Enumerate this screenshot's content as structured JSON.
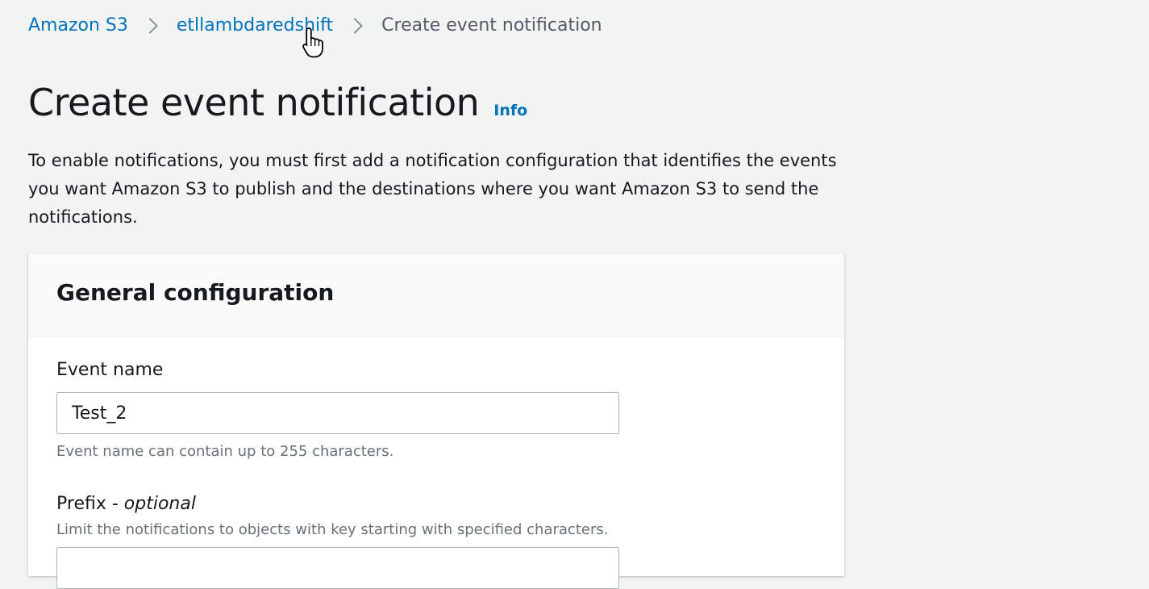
{
  "breadcrumb": {
    "items": [
      {
        "label": "Amazon S3"
      },
      {
        "label": "etllambdaredshift"
      },
      {
        "label": "Create event notification"
      }
    ]
  },
  "header": {
    "title": "Create event notification",
    "info_label": "Info"
  },
  "description": "To enable notifications, you must first add a notification configuration that identifies the events you want Amazon S3 to publish and the destinations where you want Amazon S3 to send the notifications.",
  "general_configuration": {
    "title": "General configuration",
    "event_name": {
      "label": "Event name",
      "value": "Test_2",
      "hint": "Event name can contain up to 255 characters."
    },
    "prefix": {
      "label": "Prefix",
      "label_suffix": "optional",
      "description": "Limit the notifications to objects with key starting with specified characters.",
      "value": ""
    }
  },
  "colors": {
    "link": "#0073bb",
    "background": "#f2f3f3",
    "text": "#16191f",
    "secondary_text": "#687078"
  },
  "icons": {
    "breadcrumb_separator": "chevron-right-icon",
    "pointer": "hand-pointer-cursor-icon"
  }
}
